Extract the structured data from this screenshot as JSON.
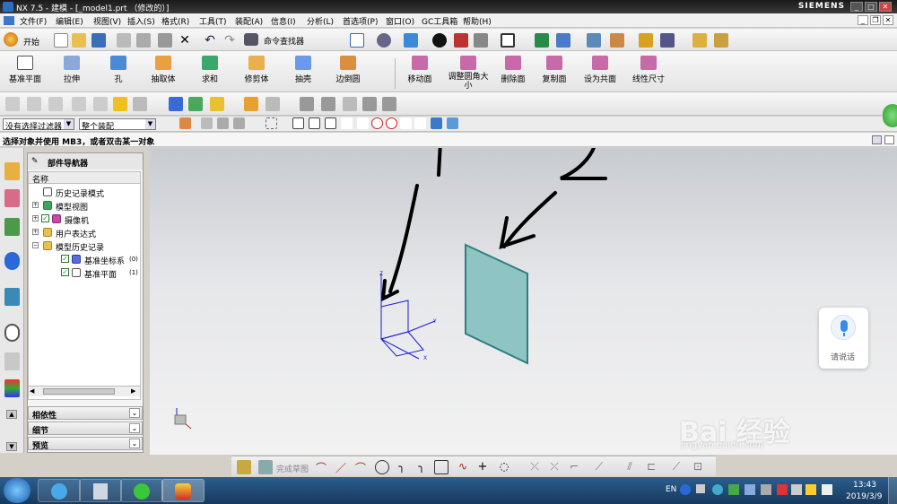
{
  "window": {
    "title": "NX 7.5 - 建模 - [_model1.prt （修改的）]",
    "brand": "SIEMENS"
  },
  "menubar": {
    "items": [
      "文件(F)",
      "编辑(E)",
      "视图(V)",
      "插入(S)",
      "格式(R)",
      "工具(T)",
      "装配(A)",
      "信息(I)",
      "分析(L)",
      "首选项(P)",
      "窗口(O)",
      "GC工具箱",
      "帮助(H)"
    ]
  },
  "toolbar1": {
    "start_label": "开始",
    "command_finder_label": "命令查找器"
  },
  "feature_toolbar": {
    "items": [
      "基准平面",
      "拉伸",
      "孔",
      "抽取体",
      "求和",
      "修剪体",
      "抽壳",
      "边倒圆"
    ]
  },
  "sync_toolbar": {
    "items": [
      "移动面",
      "调整圆角大小",
      "删除面",
      "复制面",
      "设为共面",
      "线性尺寸"
    ]
  },
  "selection_bar": {
    "filter_value": "没有选择过滤器",
    "scope_value": "整个装配"
  },
  "cue_line": "选择对象并使用 MB3，或者双击某一对象",
  "navigator": {
    "title": "部件导航器",
    "column_header": "名称",
    "nodes": [
      {
        "label": "历史记录模式",
        "indent": 0
      },
      {
        "label": "模型视图",
        "indent": 0
      },
      {
        "label": "摄像机",
        "indent": 0
      },
      {
        "label": "用户表达式",
        "indent": 0
      },
      {
        "label": "模型历史记录",
        "indent": 0
      },
      {
        "label": "基准坐标系",
        "suffix": "(0)",
        "indent": 1
      },
      {
        "label": "基准平面",
        "suffix": "(1)",
        "indent": 1
      }
    ],
    "panels": [
      "相依性",
      "细节",
      "预览"
    ]
  },
  "annotations": {
    "one": "1",
    "two": "2"
  },
  "triad_labels": {
    "x": "X",
    "y": "Y",
    "z": "Z"
  },
  "voice_button": {
    "label": "请说话"
  },
  "watermark": {
    "text": "Bai 经验",
    "url": "jingyan.baidu.com"
  },
  "sketch_toolbar": {
    "finish_label": "完成草图"
  },
  "tray": {
    "lang": "EN",
    "time": "13:43",
    "date": "2019/3/9"
  },
  "colors": {
    "plane_fill": "#8fc4c4",
    "plane_edge": "#2f7f7f",
    "triad": "#1a1ad6"
  }
}
